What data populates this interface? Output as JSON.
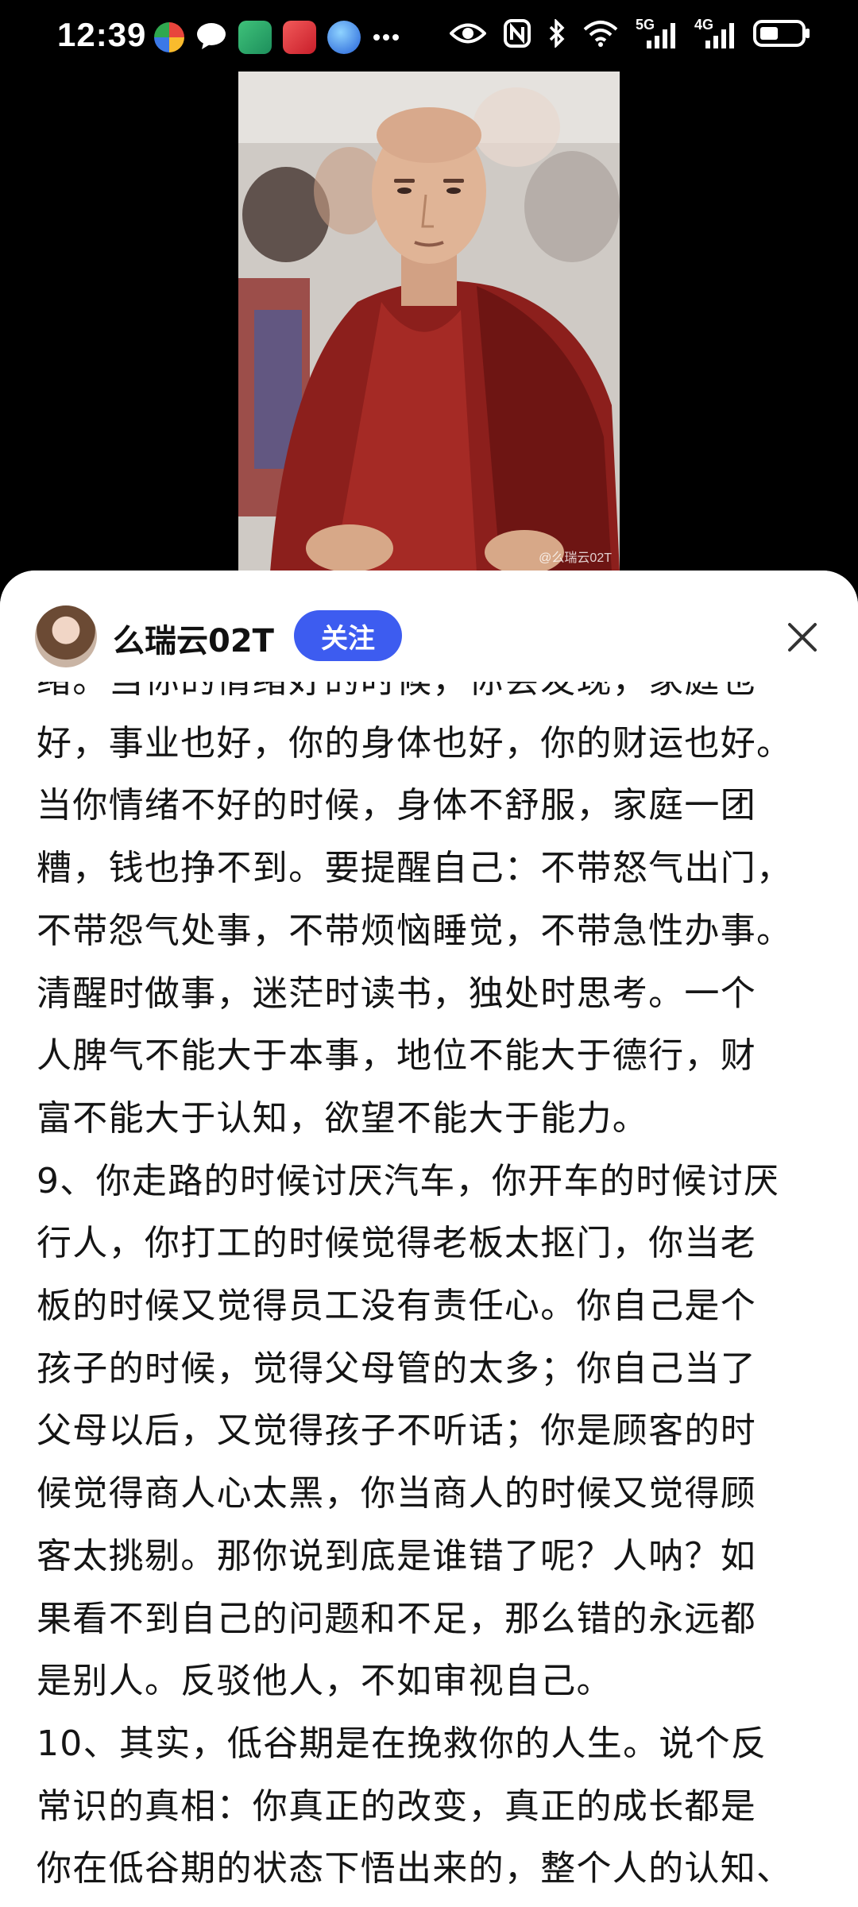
{
  "status_bar": {
    "time": "12:39",
    "network_5g": "5G",
    "network_4g": "4G",
    "nfc_label": "N"
  },
  "video": {
    "watermark": "@么瑞云02T"
  },
  "author": {
    "name": "么瑞云02T",
    "follow_label": "关注"
  },
  "article": {
    "lines": [
      "绪。当你的情绪好的时候，你会发现，家庭也",
      "好，事业也好，你的身体也好，你的财运也好。",
      "当你情绪不好的时候，身体不舒服，家庭一团",
      "糟，钱也挣不到。要提醒自己：不带怒气出门，",
      "不带怨气处事，不带烦恼睡觉，不带急性办事。",
      "清醒时做事，迷茫时读书，独处时思考。一个",
      "人脾气不能大于本事，地位不能大于德行，财",
      "富不能大于认知，欲望不能大于能力。",
      "9、你走路的时候讨厌汽车，你开车的时候讨厌",
      "行人，你打工的时候觉得老板太抠门，你当老",
      "板的时候又觉得员工没有责任心。你自己是个",
      "孩子的时候，觉得父母管的太多；你自己当了",
      "父母以后，又觉得孩子不听话；你是顾客的时",
      "候觉得商人心太黑，你当商人的时候又觉得顾",
      "客太挑剔。那你说到底是谁错了呢？人呐？如",
      "果看不到自己的问题和不足，那么错的永远都",
      "是别人。反驳他人，不如审视自己。",
      "10、其实，低谷期是在挽救你的人生。说个反",
      "常识的真相：你真正的改变，真正的成长都是",
      "你在低谷期的状态下悟出来的，整个人的认知、"
    ]
  },
  "colors": {
    "follow_button_bg": "#3d5cf0",
    "text": "#151515",
    "sheet_bg": "#ffffff"
  }
}
